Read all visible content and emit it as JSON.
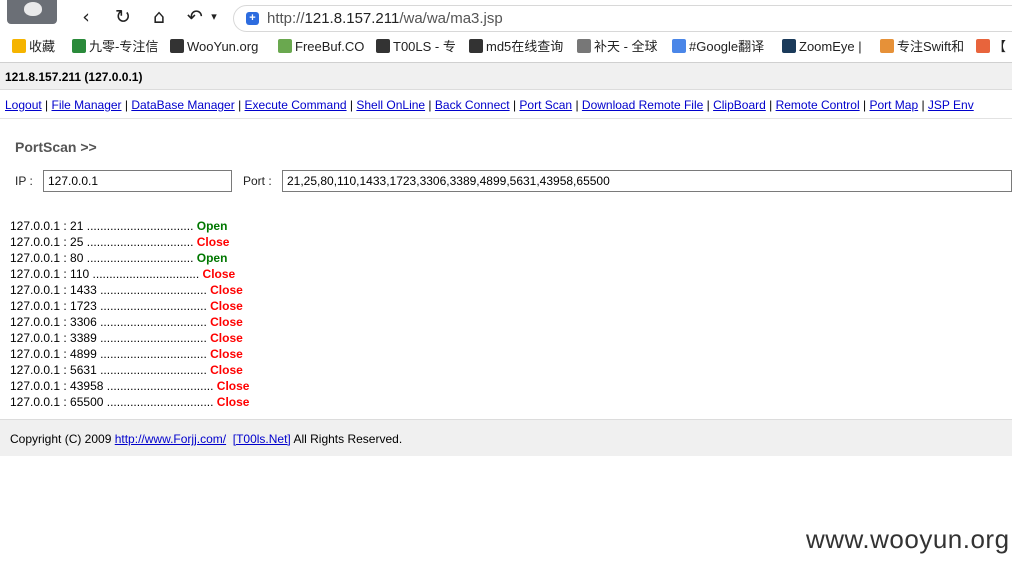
{
  "browser": {
    "url_scheme": "http://",
    "url_host": "121.8.157.211",
    "url_path": "/wa/wa/ma3.jsp",
    "bookmarks": [
      {
        "label": "收藏",
        "icon": "star-icon",
        "color": "#f5b400"
      },
      {
        "label": "九零-专注信",
        "icon": "figure-icon",
        "color": "#2a8a3a"
      },
      {
        "label": "WooYun.org",
        "icon": "wooyun-icon",
        "color": "#333333"
      },
      {
        "label": "FreeBuf.CO",
        "icon": "freebuf-icon",
        "color": "#6aa84f"
      },
      {
        "label": "T00LS - 专",
        "icon": "tools-icon",
        "color": "#333333"
      },
      {
        "label": "md5在线查询",
        "icon": "grid-icon",
        "color": "#333333"
      },
      {
        "label": "补天 - 全球",
        "icon": "butian-icon",
        "color": "#777777"
      },
      {
        "label": "#Google翻译",
        "icon": "translate-icon",
        "color": "#4a86e8"
      },
      {
        "label": "ZoomEye |",
        "icon": "eye-icon",
        "color": "#1a3a5a"
      },
      {
        "label": "专注Swift和",
        "icon": "bird-icon",
        "color": "#e69138"
      },
      {
        "label": "【",
        "icon": "swift-icon",
        "color": "#e8643c"
      }
    ]
  },
  "page": {
    "host_title": "121.8.157.211 (127.0.0.1)",
    "menu": [
      "Logout",
      "File Manager",
      "DataBase Manager",
      "Execute Command",
      "Shell OnLine",
      "Back Connect",
      "Port Scan",
      "Download Remote File",
      "ClipBoard",
      "Remote Control",
      "Port Map",
      "JSP Env"
    ],
    "scan_title": "PortScan >>",
    "ip_label": "IP :",
    "ip_value": "127.0.0.1",
    "port_label": "Port :",
    "port_value": "21,25,80,110,1433,1723,3306,3389,4899,5631,43958,65500",
    "results": [
      {
        "host": "127.0.0.1 : 21",
        "dots": " ................................ ",
        "status": "Open"
      },
      {
        "host": "127.0.0.1 : 25",
        "dots": " ................................ ",
        "status": "Close"
      },
      {
        "host": "127.0.0.1 : 80",
        "dots": " ................................ ",
        "status": "Open"
      },
      {
        "host": "127.0.0.1 : 110",
        "dots": " ................................ ",
        "status": "Close"
      },
      {
        "host": "127.0.0.1 : 1433",
        "dots": " ................................ ",
        "status": "Close"
      },
      {
        "host": "127.0.0.1 : 1723",
        "dots": " ................................ ",
        "status": "Close"
      },
      {
        "host": "127.0.0.1 : 3306",
        "dots": " ................................ ",
        "status": "Close"
      },
      {
        "host": "127.0.0.1 : 3389",
        "dots": " ................................ ",
        "status": "Close"
      },
      {
        "host": "127.0.0.1 : 4899",
        "dots": " ................................ ",
        "status": "Close"
      },
      {
        "host": "127.0.0.1 : 5631",
        "dots": " ................................ ",
        "status": "Close"
      },
      {
        "host": "127.0.0.1 : 43958",
        "dots": " ................................ ",
        "status": "Close"
      },
      {
        "host": "127.0.0.1 : 65500",
        "dots": " ................................ ",
        "status": "Close"
      }
    ],
    "footer_prefix": "Copyright (C) 2009 ",
    "footer_link1": "http://www.Forjj.com/",
    "footer_link2": "[T00ls.Net]",
    "footer_suffix": " All Rights Reserved."
  },
  "watermark": "www.wooyun.org"
}
